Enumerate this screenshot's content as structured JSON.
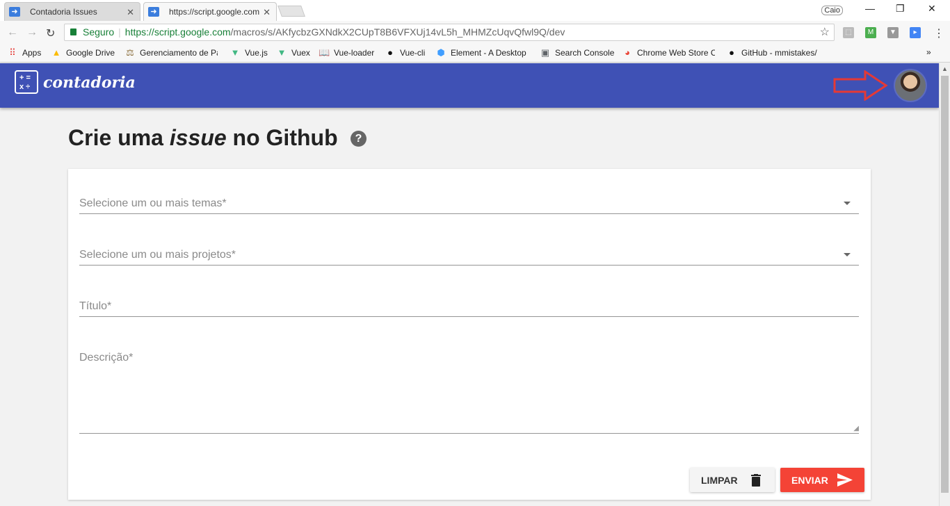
{
  "browser": {
    "tabs": [
      {
        "label": "Contadoria Issues",
        "active": false
      },
      {
        "label": "https://script.google.com",
        "active": true
      }
    ],
    "profile": "Caio",
    "omnibox": {
      "secure_label": "Seguro",
      "url_host": "https://script.google.com",
      "url_path": "/macros/s/AKfycbzGXNdkX2CUpT8B6VFXUj14vL5h_MHMZcUqvQfwl9Q/dev"
    },
    "bookmarks": [
      {
        "label": "Apps",
        "icon": "apps-grid-icon"
      },
      {
        "label": "Google Drive",
        "icon": "google-drive-icon"
      },
      {
        "label": "Gerenciamento de Pa",
        "icon": "scales-icon"
      },
      {
        "label": "Vue.js",
        "icon": "vue-icon"
      },
      {
        "label": "Vuex",
        "icon": "vue-icon"
      },
      {
        "label": "Vue-loader",
        "icon": "book-icon"
      },
      {
        "label": "Vue-cli",
        "icon": "github-icon"
      },
      {
        "label": "Element - A Desktop",
        "icon": "element-icon"
      },
      {
        "label": "Search Console",
        "icon": "search-console-icon"
      },
      {
        "label": "Chrome Web Store C",
        "icon": "chrome-store-icon"
      },
      {
        "label": "GitHub - mmistakes/",
        "icon": "github-icon"
      }
    ],
    "bookmarks_more": "»"
  },
  "app": {
    "logo_symbols": "+ =\nx ÷",
    "logo_text": "contadoria",
    "title": {
      "part1": "Crie uma ",
      "part2": "issue",
      "part3": " no ",
      "part4": "Github"
    },
    "help_glyph": "?",
    "form": {
      "themes_placeholder": "Selecione um ou mais temas*",
      "projects_placeholder": "Selecione um ou mais projetos*",
      "title_placeholder": "Título*",
      "description_placeholder": "Descrição*"
    },
    "buttons": {
      "clear": "LIMPAR",
      "send": "ENVIAR"
    },
    "colors": {
      "primary": "#3f51b5",
      "accent": "#f44336",
      "annotation_arrow": "#e53935"
    }
  }
}
